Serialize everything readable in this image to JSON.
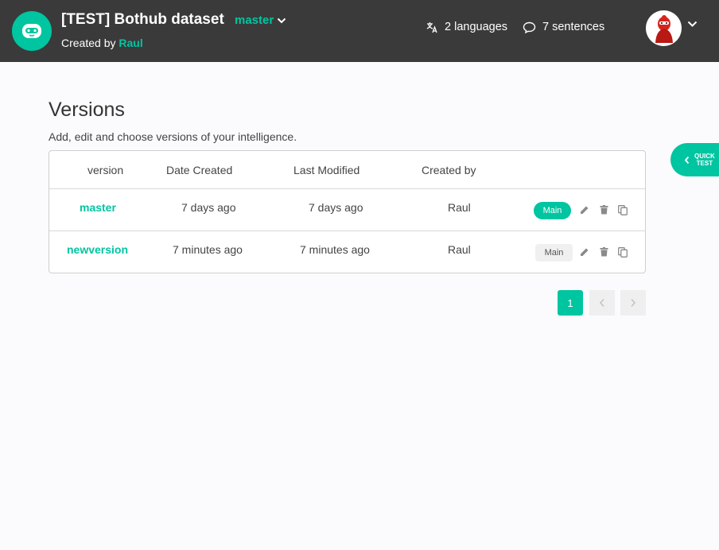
{
  "header": {
    "repository_title": "[TEST] Bothub dataset",
    "branch": "master",
    "created_by_prefix": "Created by",
    "created_by_name": "Raul",
    "languages": "2 languages",
    "sentences": "7 sentences"
  },
  "page": {
    "title": "Versions",
    "subtitle": "Add, edit and choose versions of your intelligence."
  },
  "table": {
    "columns": [
      "version",
      "Date Created",
      "Last Modified",
      "Created by"
    ],
    "rows": [
      {
        "name": "master",
        "date_created": "7 days ago",
        "last_modified": "7 days ago",
        "created_by": "Raul",
        "badge": "Main",
        "is_main": true
      },
      {
        "name": "newversion",
        "date_created": "7 minutes ago",
        "last_modified": "7 minutes ago",
        "created_by": "Raul",
        "badge": "Main",
        "is_main": false
      }
    ]
  },
  "pagination": {
    "current_page": "1",
    "prev_icon": "chevron-left-icon",
    "next_icon": "chevron-right-icon"
  },
  "quick_test": {
    "line1": "QUICK",
    "line2": "TEST"
  },
  "colors": {
    "accent": "#00c5a1",
    "topbar": "#3a3a3a",
    "background": "#fbfbfd"
  }
}
